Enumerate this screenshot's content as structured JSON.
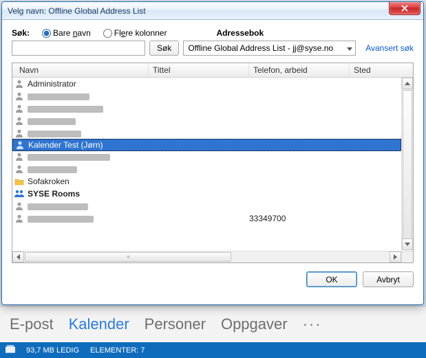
{
  "dialog": {
    "title": "Velg navn: Offline Global Address List",
    "search_label": "Søk:",
    "radio_name": "Bare navn",
    "radio_cols": "Flere kolonner",
    "addressbook_label": "Adressebok",
    "search_btn": "Søk",
    "addressbook_value": "Offline Global Address List - jj@syse.no",
    "advanced_link": "Avansert søk",
    "columns": {
      "name": "Navn",
      "title": "Tittel",
      "phone": "Telefon, arbeid",
      "place": "Sted"
    },
    "ok": "OK",
    "cancel": "Avbryt"
  },
  "rows": [
    {
      "icon": "person",
      "name": "Administrator",
      "obf": false
    },
    {
      "icon": "person",
      "obf": true,
      "obfw": 90
    },
    {
      "icon": "person",
      "obf": true,
      "obfw": 110
    },
    {
      "icon": "person",
      "obf": true,
      "obfw": 70
    },
    {
      "icon": "person",
      "obf": true,
      "obfw": 78
    },
    {
      "icon": "person",
      "name": "Kalender Test (Jørn)",
      "obf": false,
      "selected": true
    },
    {
      "icon": "person",
      "obf": true,
      "obfw": 120
    },
    {
      "icon": "person",
      "obf": true,
      "obfw": 72
    },
    {
      "icon": "folder",
      "name": "Sofakroken",
      "obf": false
    },
    {
      "icon": "group",
      "name": "SYSE Rooms",
      "obf": false,
      "bold": true
    },
    {
      "icon": "person",
      "obf": true,
      "obfw": 88
    },
    {
      "icon": "person",
      "obf": true,
      "obfw": 96,
      "phone": "33349700"
    }
  ],
  "nav": {
    "items": [
      "E-post",
      "Kalender",
      "Personer",
      "Oppgaver"
    ],
    "active_index": 1,
    "more": "···"
  },
  "status": {
    "free": "93,7 MB LEDIG",
    "items": "ELEMENTER: 7"
  }
}
